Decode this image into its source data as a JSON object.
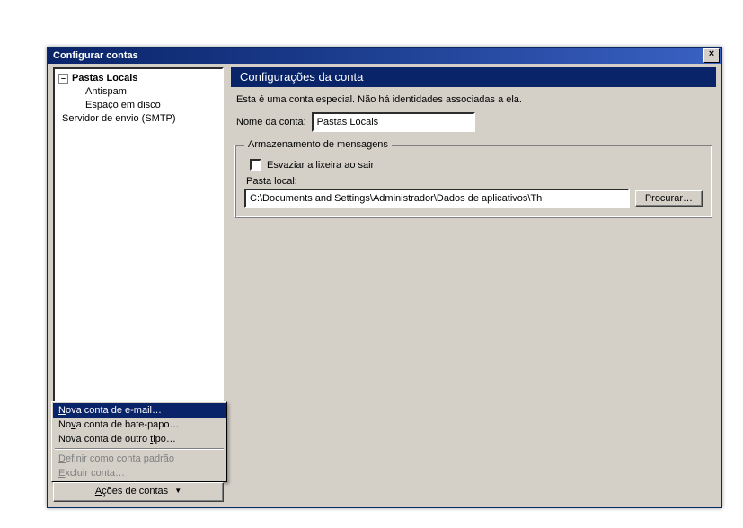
{
  "titlebar": {
    "title": "Configurar contas",
    "close_glyph": "×"
  },
  "tree": {
    "expando_glyph": "–",
    "root": "Pastas Locais",
    "children": [
      "Antispam",
      "Espaço em disco"
    ],
    "smtp": "Servidor de envio (SMTP)"
  },
  "context_menu": {
    "items": [
      {
        "pre": "",
        "u": "N",
        "post": "ova conta de e-mail…",
        "selected": true,
        "disabled": false
      },
      {
        "pre": "No",
        "u": "v",
        "post": "a conta de bate-papo…",
        "selected": false,
        "disabled": false
      },
      {
        "pre": "Nova conta de outro ",
        "u": "t",
        "post": "ipo…",
        "selected": false,
        "disabled": false
      }
    ],
    "items2": [
      {
        "pre": "",
        "u": "D",
        "post": "efinir como conta padrão",
        "selected": false,
        "disabled": true
      },
      {
        "pre": "",
        "u": "E",
        "post": "xcluir conta…",
        "selected": false,
        "disabled": true
      }
    ]
  },
  "actions_dropdown": {
    "label": "Ações de contas",
    "caret": "▼"
  },
  "right": {
    "header": "Configurações da conta",
    "desc": "Esta é uma conta especial. Não há identidades associadas a ela.",
    "account_name_label": "Nome da conta:",
    "account_name_value": "Pastas Locais",
    "storage_legend": "Armazenamento de mensagens",
    "empty_trash_label": "Esvaziar a lixeira ao sair",
    "local_folder_label": "Pasta local:",
    "path_value": "C:\\Documents and Settings\\Administrador\\Dados de aplicativos\\Th",
    "browse_label": "Procurar…"
  }
}
